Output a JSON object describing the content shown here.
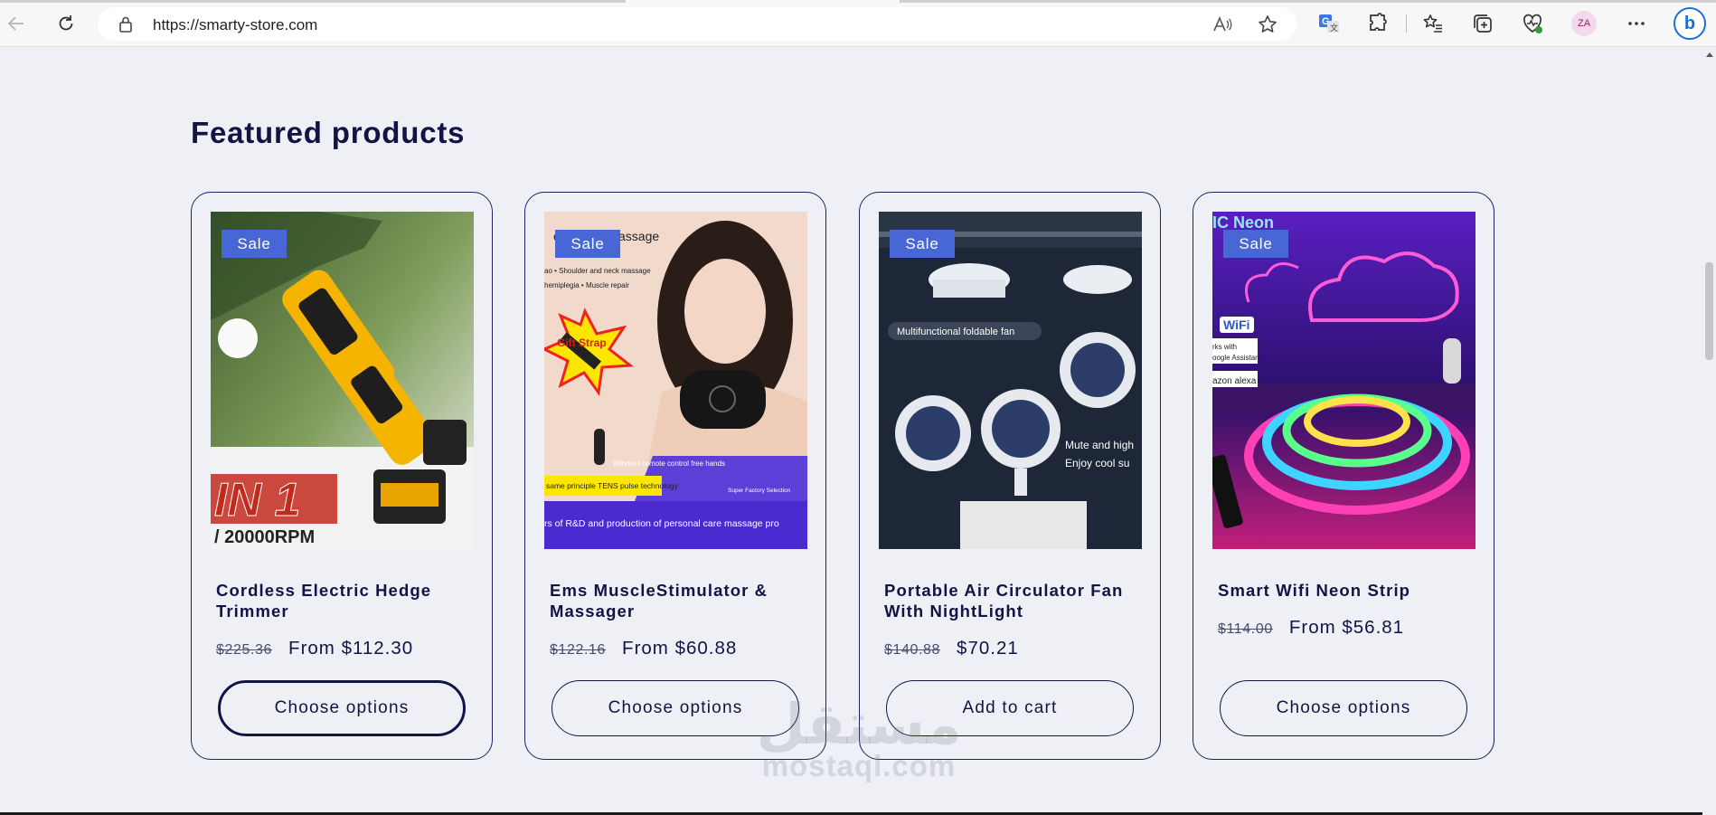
{
  "browser": {
    "url": "https://smarty-store.com",
    "profile_initials": "ZA",
    "icons": [
      "back-icon",
      "refresh-icon",
      "lock-icon",
      "read-aloud-icon",
      "favorite-star-icon",
      "translate-icon",
      "extensions-icon",
      "favorites-icon",
      "collections-icon",
      "browser-essentials-icon",
      "more-icon",
      "bing-icon"
    ]
  },
  "section": {
    "title": "Featured products"
  },
  "products": [
    {
      "badge": "Sale",
      "title": "Cordless Electric Hedge Trimmer",
      "old_price": "$225.36",
      "price": "From $112.30",
      "button": "Choose options",
      "image_text": "IN 1",
      "image_subtext": "/ 20000RPM"
    },
    {
      "badge": "Sale",
      "title": "Ems MuscleStimulator & Massager",
      "old_price": "$122.16",
      "price": "From $60.88",
      "button": "Choose options",
      "image_text": "Gift Strap",
      "image_lines": [
        "co",
        "assage",
        "ao • Shoulder and neck massage",
        "hemiplegia • Muscle repair",
        "Wireless remote control free hands",
        "same principle TENS pulse technology",
        "Super Factory Selection",
        "rs of R&D and production of personal care massage pro"
      ]
    },
    {
      "badge": "Sale",
      "title": "Portable Air Circulator Fan With NightLight",
      "old_price": "$140.88",
      "price": "$70.21",
      "button": "Add to cart",
      "image_lines": [
        "Multifunctional foldable fan",
        "Mute and high",
        "Enjoy cool su"
      ]
    },
    {
      "badge": "Sale",
      "title": "Smart Wifi Neon Strip",
      "old_price": "$114.00",
      "price": "From $56.81",
      "button": "Choose options",
      "image_lines": [
        "IC Neon",
        "WiFi",
        "rks with",
        "oogle Assistant",
        "azon alexa"
      ]
    }
  ],
  "watermark": {
    "arabic": "مستقل",
    "latin": "mostaql.com"
  }
}
